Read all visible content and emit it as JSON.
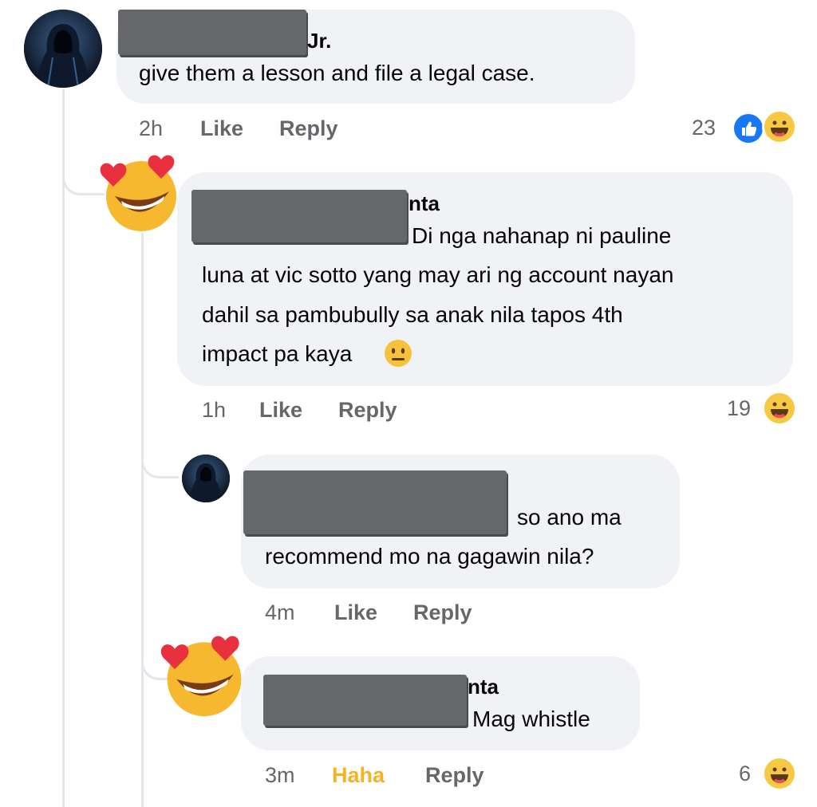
{
  "comments": [
    {
      "name_suffix": "Jr.",
      "text": "give them a lesson and file a legal case.",
      "time": "2h",
      "like_label": "Like",
      "reply_label": "Reply",
      "reaction_count": "23",
      "reactions": [
        "like-icon",
        "haha-icon"
      ]
    },
    {
      "name_suffix": "nta",
      "text_line1": "Di nga nahanap ni pauline",
      "text_line2": "luna at vic sotto yang may ari ng account nayan",
      "text_line3": "dahil sa pambubully sa anak nila tapos 4th",
      "text_line4": "impact pa kaya",
      "emoji": "neutral-face-icon",
      "time": "1h",
      "like_label": "Like",
      "reply_label": "Reply",
      "reaction_count": "19",
      "reactions": [
        "haha-icon"
      ]
    },
    {
      "text_line1": "so ano ma",
      "text_line2": "recommend mo na gagawin nila?",
      "time": "4m",
      "like_label": "Like",
      "reply_label": "Reply"
    },
    {
      "name_suffix": "nta",
      "text": "Mag whistle",
      "time": "3m",
      "like_label": "Haha",
      "reply_label": "Reply",
      "reaction_count": "6",
      "reactions": [
        "haha-icon"
      ]
    }
  ],
  "colors": {
    "bubble": "#f0f2f5",
    "meta": "#65676b",
    "like": "#1877f2",
    "haha": "#f7b125",
    "thread_line": "#e4e6eb"
  }
}
